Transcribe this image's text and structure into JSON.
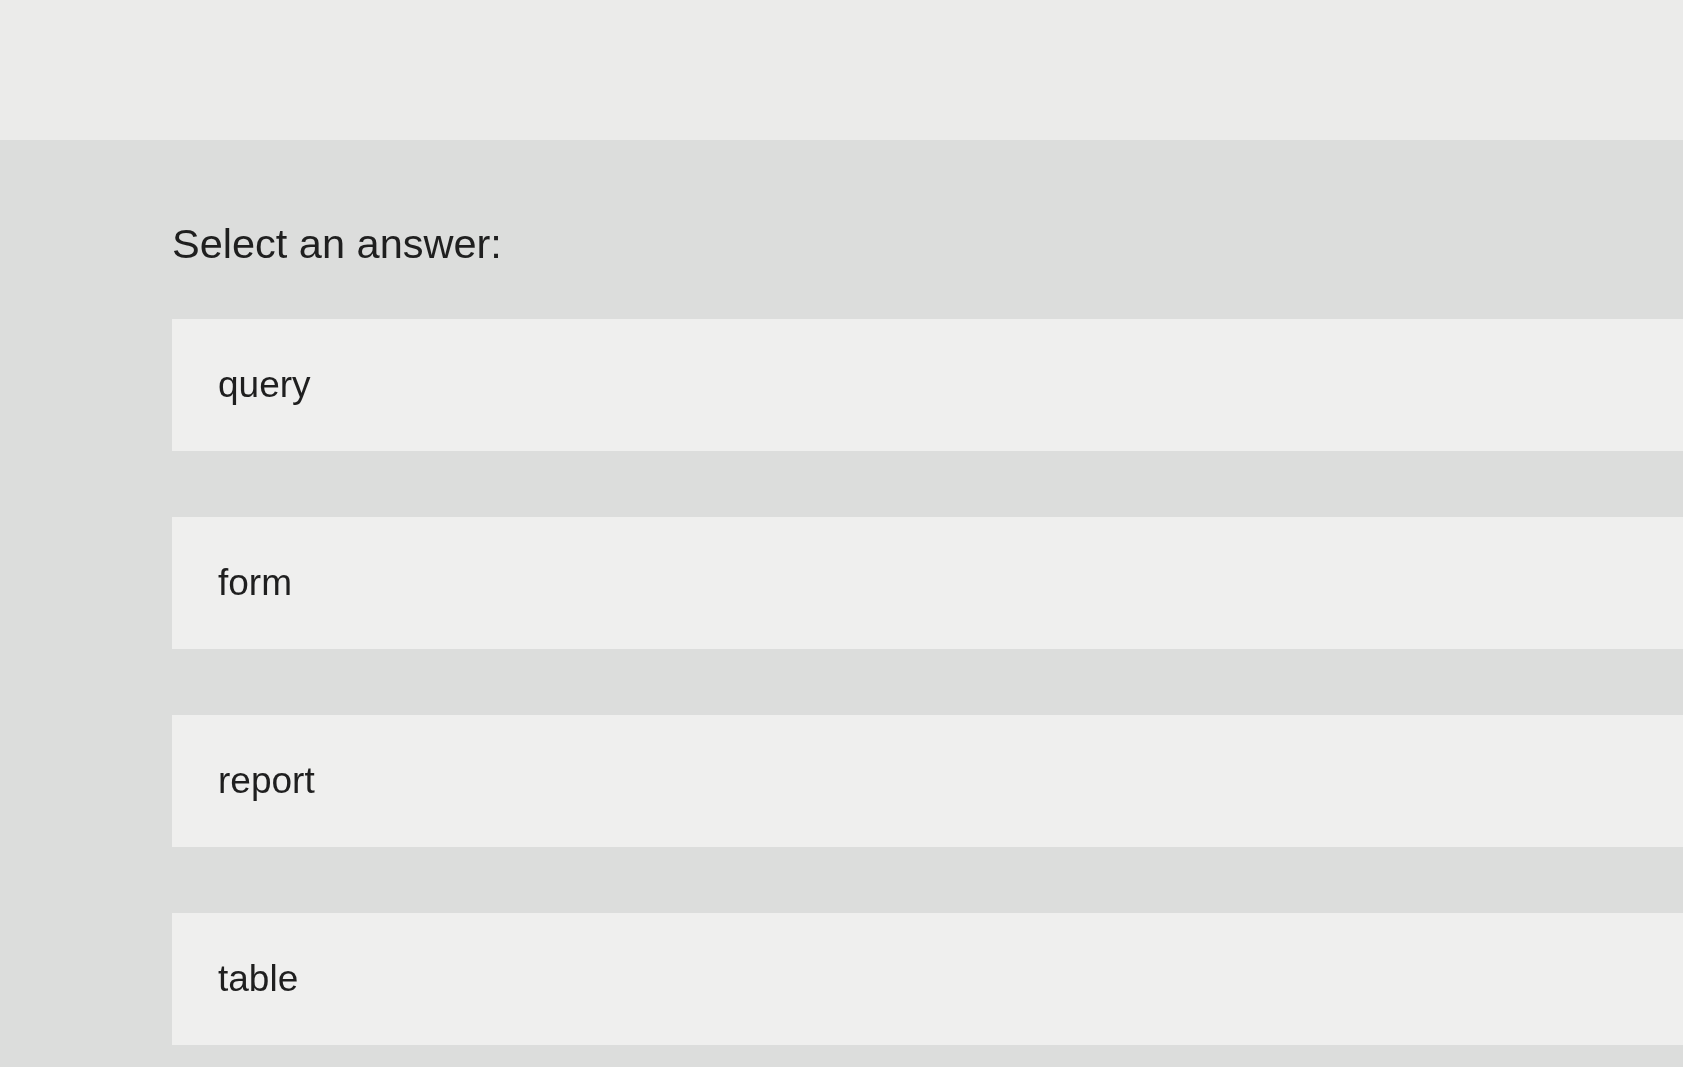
{
  "prompt": "Select an answer:",
  "options": [
    {
      "label": "query",
      "selected": false
    },
    {
      "label": "form",
      "selected": false
    },
    {
      "label": "report",
      "selected": false
    },
    {
      "label": "table",
      "selected": false
    }
  ]
}
